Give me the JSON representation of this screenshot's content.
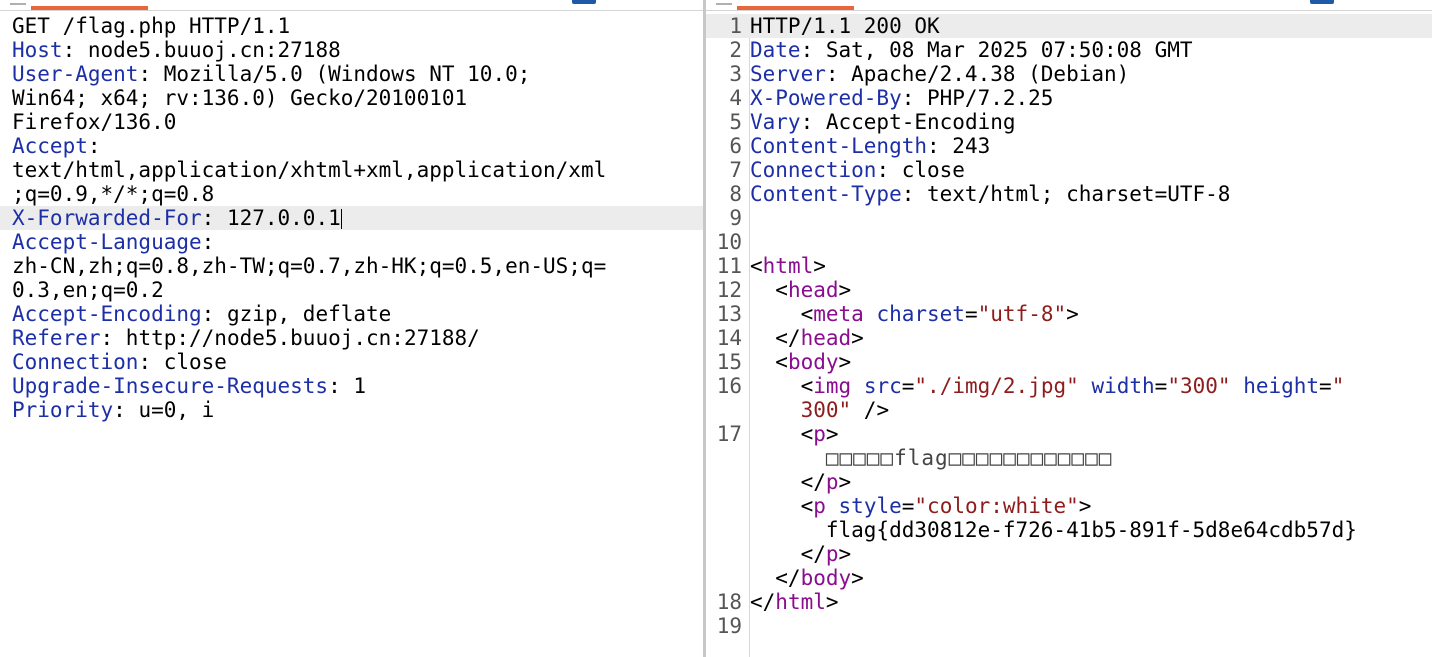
{
  "request": {
    "lines": [
      {
        "key": "",
        "value": "GET /flag.php HTTP/1.1"
      },
      {
        "key": "Host",
        "value": ": node5.buuoj.cn:27188"
      },
      {
        "key": "User-Agent",
        "value": ": Mozilla/5.0 (Windows NT 10.0;"
      },
      {
        "key": "",
        "value": "Win64; x64; rv:136.0) Gecko/20100101"
      },
      {
        "key": "",
        "value": "Firefox/136.0"
      },
      {
        "key": "Accept",
        "value": ":"
      },
      {
        "key": "",
        "value": "text/html,application/xhtml+xml,application/xml"
      },
      {
        "key": "",
        "value": ";q=0.9,*/*;q=0.8"
      },
      {
        "key": "X-Forwarded-For",
        "value": ": 127.0.0.1"
      },
      {
        "key": "Accept-Language",
        "value": ":"
      },
      {
        "key": "",
        "value": "zh-CN,zh;q=0.8,zh-TW;q=0.7,zh-HK;q=0.5,en-US;q="
      },
      {
        "key": "",
        "value": "0.3,en;q=0.2"
      },
      {
        "key": "Accept-Encoding",
        "value": ": gzip, deflate"
      },
      {
        "key": "Referer",
        "value": ": http://node5.buuoj.cn:27188/"
      },
      {
        "key": "Connection",
        "value": ": close"
      },
      {
        "key": "Upgrade-Insecure-Requests",
        "value": ": 1"
      },
      {
        "key": "Priority",
        "value": ": u=0, i"
      }
    ]
  },
  "response": {
    "line_numbers": [
      "1",
      "2",
      "3",
      "4",
      "5",
      "6",
      "7",
      "8",
      "9",
      "10",
      "11",
      "12",
      "13",
      "14",
      "15",
      "16",
      "17",
      "18",
      "19"
    ],
    "headers": [
      {
        "key": "",
        "value": "HTTP/1.1 200 OK"
      },
      {
        "key": "Date",
        "value": ": Sat, 08 Mar 2025 07:50:08 GMT"
      },
      {
        "key": "Server",
        "value": ": Apache/2.4.38 (Debian)"
      },
      {
        "key": "X-Powered-By",
        "value": ": PHP/7.2.25"
      },
      {
        "key": "Vary",
        "value": ": Accept-Encoding"
      },
      {
        "key": "Content-Length",
        "value": ": 243"
      },
      {
        "key": "Connection",
        "value": ": close"
      },
      {
        "key": "Content-Type",
        "value": ": text/html; charset=UTF-8"
      }
    ],
    "html": {
      "html_tag": "html",
      "head_tag": "head",
      "meta_tag": "meta",
      "meta_attr": "charset",
      "meta_val": "\"utf-8\"",
      "body_tag": "body",
      "img_tag": "img",
      "img_src_attr": "src",
      "img_src_val": "\"./img/2.jpg\"",
      "img_width_attr": "width",
      "img_width_val": "\"300\"",
      "img_height_attr": "height",
      "img_height_val_a": "\"",
      "img_height_val_b": "300\"",
      "p_tag": "p",
      "p_text": "□□□□□flag□□□□□□□□□□□□",
      "style_attr": "style",
      "style_val": "\"color:white\"",
      "flag_text": "flag{dd30812e-f726-41b5-891f-5d8e64cdb57d}"
    }
  },
  "colors": {
    "header_key": "#1d2fa6",
    "tag": "#8a0d8f",
    "attr": "#1d2fa6",
    "value": "#8d1d1d",
    "tab_accent": "#e8663c",
    "marker_blue": "#1e5aa8",
    "highlight_row": "#ececec"
  }
}
